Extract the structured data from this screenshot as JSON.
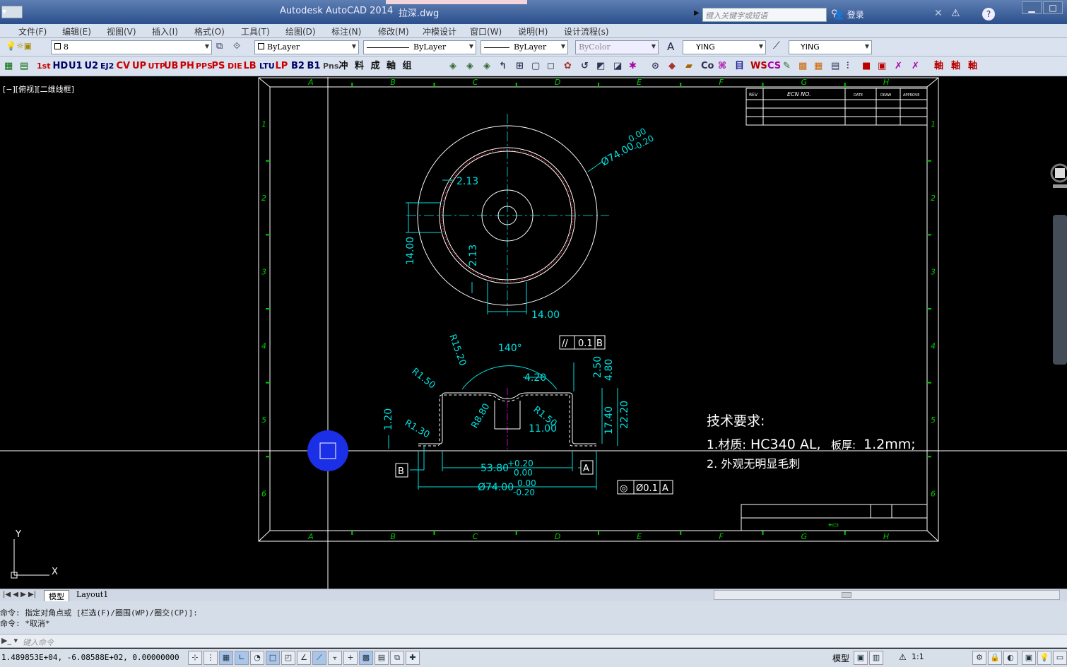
{
  "app": {
    "title": "Autodesk AutoCAD 2014",
    "file": "拉深.dwg",
    "search_placeholder": "键入关键字或短语",
    "login": "登录"
  },
  "menu": [
    "文件(F)",
    "编辑(E)",
    "视图(V)",
    "插入(I)",
    "格式(O)",
    "工具(T)",
    "绘图(D)",
    "标注(N)",
    "修改(M)",
    "冲模设计",
    "窗口(W)",
    "说明(H)",
    "设计流程(s)"
  ],
  "toolbar": {
    "layer": "8",
    "color": "ByLayer",
    "linetype": "ByLayer",
    "lineweight": "ByLayer",
    "plotstyle": "ByColor",
    "textstyle": "YING",
    "dimstyle": "YING",
    "macro_buttons": [
      "1st",
      "HD",
      "U1",
      "U2",
      "EJ2",
      "CV",
      "UP",
      "UTP",
      "UB",
      "PH",
      "PPS",
      "PS",
      "DIE",
      "LB",
      "LTU",
      "LP",
      "B2",
      "B1",
      "Pns",
      "冲",
      "料",
      "成",
      "軸",
      "组"
    ]
  },
  "viewport": {
    "label": "[−][俯视][二维线框]"
  },
  "drawing": {
    "columns": [
      "A",
      "B",
      "C",
      "D",
      "E",
      "F",
      "G",
      "H"
    ],
    "rows": [
      "1",
      "2",
      "3",
      "4",
      "5",
      "6"
    ],
    "revision_headers": [
      "REV",
      "ECN NO.",
      "DATE",
      "DRAW",
      "APPROVE"
    ],
    "dims_top": {
      "dia": "Ø74.00",
      "tol_hi": "0.00",
      "tol_lo": "-0.20",
      "wall1": "2.13",
      "wall2": "2.13",
      "height": "14.00",
      "bottom": "14.00"
    },
    "dims_side": {
      "r1": "R15.20",
      "angle": "140°",
      "r2": "R1.50",
      "r3": "R8.80",
      "r4": "R1.50",
      "r5": "R1.30",
      "w1": "4.20",
      "w2": "11.00",
      "h1": "2.50",
      "h2": "4.80",
      "h3": "17.40",
      "h4": "22.20",
      "t": "1.20",
      "d1": "53.80",
      "d1_hi": "+0.20",
      "d1_lo": "0.00",
      "d2": "Ø74.00",
      "d2_hi": "0.00",
      "d2_lo": "-0.20",
      "parallel_sym": "//",
      "parallel_tol": "0.1",
      "parallel_ref": "B",
      "conc_sym": "◎",
      "conc_tol": "Ø0.1",
      "conc_ref": "A",
      "datum_a": "A",
      "datum_b": "B"
    },
    "notes": {
      "title": "技术要求:",
      "line1_a": "1.材质:",
      "line1_b": "HC340  AL,",
      "line1_c": "板厚:",
      "line1_d": "1.2mm;",
      "line2": "2. 外观无明显毛刺"
    }
  },
  "tabs": [
    "模型",
    "Layout1"
  ],
  "command": {
    "history": [
      "命令: 指定对角点或 [栏选(F)/圈围(WP)/圈交(CP)]:",
      "命令: *取消*"
    ],
    "placeholder": "键入命令"
  },
  "status": {
    "coords": "1.489853E+04, -6.08588E+02, 0.00000000",
    "model": "模型",
    "scale": "1:1"
  },
  "colors": {
    "ui_bg": "#d9e2ee",
    "title_bg": "#2b4f8c",
    "canvas": "#000000",
    "frame": "#ffffff",
    "dim": "#00e0e0",
    "border_ticks": "#00c800",
    "center": "#00b4b4",
    "red": "#d0202f",
    "magenta": "#c000c0",
    "cursor": "#1a2fe6"
  },
  "icons": [
    "search-icon",
    "binoculars-icon",
    "user-icon",
    "exchange-icon",
    "help-icon",
    "minimize-icon",
    "maximize-icon",
    "ucs-icon",
    "navwheel-icon"
  ]
}
